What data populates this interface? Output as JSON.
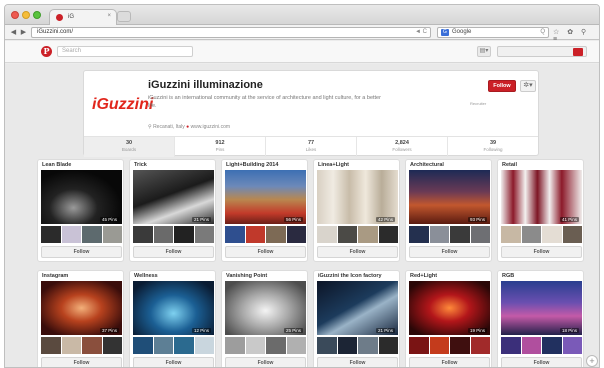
{
  "browser": {
    "tab_title": "iG",
    "tab_close": "×",
    "url": "iGuzzini.com/",
    "url_right": "◄ C",
    "search_engine": "Google",
    "search_right": "Q",
    "tool_icons": "☆ ✿ ⚲ ≡"
  },
  "pinterest": {
    "logo": "P",
    "search_placeholder": "Search",
    "menu_icon": "▤▾"
  },
  "profile": {
    "brand_logo": "iGuzzini",
    "name": "iGuzzini illuminazione",
    "description": "iGuzzini is an international community at the service of architecture and light culture, for a better life.",
    "location": "Recanati, Italy",
    "website": "www.iguzzini.com",
    "meta": "Recruiter",
    "follow_label": "Follow",
    "settings_icon": "✲▾",
    "stats": [
      {
        "n": "30",
        "l": "Boards"
      },
      {
        "n": "912",
        "l": "Pins"
      },
      {
        "n": "77",
        "l": "Likes"
      },
      {
        "n": "2,824",
        "l": "Followers"
      },
      {
        "n": "39",
        "l": "Following"
      }
    ]
  },
  "boards": [
    {
      "title": "Lean Blade",
      "pins": "45 Pins",
      "follow": "Follow"
    },
    {
      "title": "Trick",
      "pins": "21 Pins",
      "follow": "Follow"
    },
    {
      "title": "Light+Building 2014",
      "pins": "56 Pins",
      "follow": "Follow"
    },
    {
      "title": "Linea+Light",
      "pins": "42 Pins",
      "follow": "Follow"
    },
    {
      "title": "Architectural",
      "pins": "93 Pins",
      "follow": "Follow"
    },
    {
      "title": "Retail",
      "pins": "41 Pins",
      "follow": "Follow"
    },
    {
      "title": "Instagram",
      "pins": "37 Pins",
      "follow": "Follow"
    },
    {
      "title": "Wellness",
      "pins": "12 Pins",
      "follow": "Follow"
    },
    {
      "title": "Vanishing Point",
      "pins": "25 Pins",
      "follow": "Follow"
    },
    {
      "title": "iGuzzini the Icon factory",
      "pins": "21 Pins",
      "follow": "Follow"
    },
    {
      "title": "Red+Light",
      "pins": "19 Pins",
      "follow": "Follow"
    },
    {
      "title": "RGB",
      "pins": "18 Pins",
      "follow": "Follow"
    }
  ],
  "plus_icon": "+"
}
